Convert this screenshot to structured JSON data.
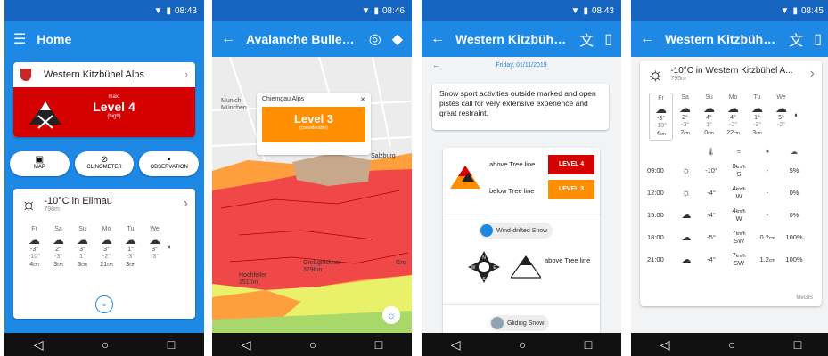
{
  "status": {
    "time1": "08:43",
    "time2": "08:46",
    "time3": "08:43",
    "time4": "08:45"
  },
  "screen1": {
    "title": "Home",
    "region": "Western Kitzbühel Alps",
    "danger_small": "max.",
    "danger_level": "Level 4",
    "danger_sub": "(high)",
    "buttons": [
      "MAP",
      "CLINOMETER",
      "OBSERVATION"
    ],
    "weather_title": "-10°C in Ellmau",
    "weather_alt": "798m",
    "days": [
      {
        "d": "Fr",
        "t1": "-3°",
        "t2": "-10°",
        "s": "4",
        "u": "cm"
      },
      {
        "d": "Sa",
        "t1": "2°",
        "t2": "-3°",
        "s": "3",
        "u": "cm"
      },
      {
        "d": "Su",
        "t1": "3°",
        "t2": "1°",
        "s": "3",
        "u": "cm"
      },
      {
        "d": "Mo",
        "t1": "3°",
        "t2": "-2°",
        "s": "21",
        "u": "cm"
      },
      {
        "d": "Tu",
        "t1": "1°",
        "t2": "-3°",
        "s": "3",
        "u": "cm"
      },
      {
        "d": "We",
        "t1": "3°",
        "t2": "-3°",
        "s": "",
        "u": ""
      }
    ]
  },
  "screen2": {
    "title": "Avalanche Bulletins",
    "popup_region": "Chiemgau Alps",
    "popup_level": "Level 3",
    "popup_sub": "(considerable)",
    "places": {
      "munich": "Munich",
      "munchen": "München",
      "salzburg": "Salzburg",
      "hochfeiler": "Hochfeiler",
      "hochfeiler_alt": "3510m",
      "glockner": "Großglockner",
      "glockner_alt": "3798m",
      "gro": "Gro"
    }
  },
  "screen3": {
    "title": "Western Kitzbühel A...",
    "date": "Friday, 01/11/2019",
    "text": "Snow sport activities outside marked and open pistes call for very extensive experience and great restraint.",
    "above": "above Tree line",
    "below": "below Tree line",
    "lvl_above": "LEVEL 4",
    "lvl_below": "LEVEL 3",
    "problem": "Wind-drifted Snow",
    "problem_above": "above Tree line",
    "problem2": "Gliding Snow",
    "compass": {
      "n": "N",
      "s": "S",
      "e": "E",
      "w": "W"
    }
  },
  "screen4": {
    "title": "Western Kitzbühel A...",
    "weather_title": "-10°C in Western Kitzbühel A...",
    "weather_alt": "795m",
    "days": [
      {
        "d": "Fr",
        "t1": "-3°",
        "t2": "-10°",
        "s": "4",
        "u": "cm"
      },
      {
        "d": "Sa",
        "t1": "2°",
        "t2": "-3°",
        "s": "2",
        "u": "cm"
      },
      {
        "d": "Su",
        "t1": "4°",
        "t2": "1°",
        "s": "0",
        "u": "cm"
      },
      {
        "d": "Mo",
        "t1": "4°",
        "t2": "-2°",
        "s": "22",
        "u": "cm"
      },
      {
        "d": "Tu",
        "t1": "1°",
        "t2": "-3°",
        "s": "3",
        "u": "cm"
      },
      {
        "d": "We",
        "t1": "5°",
        "t2": "-2°",
        "s": "",
        "u": ""
      }
    ],
    "hours": [
      {
        "t": "09:00",
        "temp": "-10°",
        "wv": "8",
        "wu": "km/h",
        "wd": "S",
        "p": "-",
        "pr": "5%"
      },
      {
        "t": "12:00",
        "temp": "-4°",
        "wv": "4",
        "wu": "km/h",
        "wd": "W",
        "p": "-",
        "pr": "0%"
      },
      {
        "t": "15:00",
        "temp": "-4°",
        "wv": "4",
        "wu": "km/h",
        "wd": "W",
        "p": "-",
        "pr": "0%"
      },
      {
        "t": "18:00",
        "temp": "-5°",
        "wv": "7",
        "wu": "km/h",
        "wd": "SW",
        "p": "0.2",
        "pu": "cm",
        "pr": "100%"
      },
      {
        "t": "21:00",
        "temp": "-4°",
        "wv": "7",
        "wu": "km/h",
        "wd": "SW",
        "p": "1.2",
        "pu": "cm",
        "pr": "100%"
      }
    ],
    "credit": "MeGIS"
  },
  "colors": {
    "primary": "#1e88e5",
    "dark": "#1565c0",
    "red": "#d50000",
    "orange": "#ff8f00"
  }
}
